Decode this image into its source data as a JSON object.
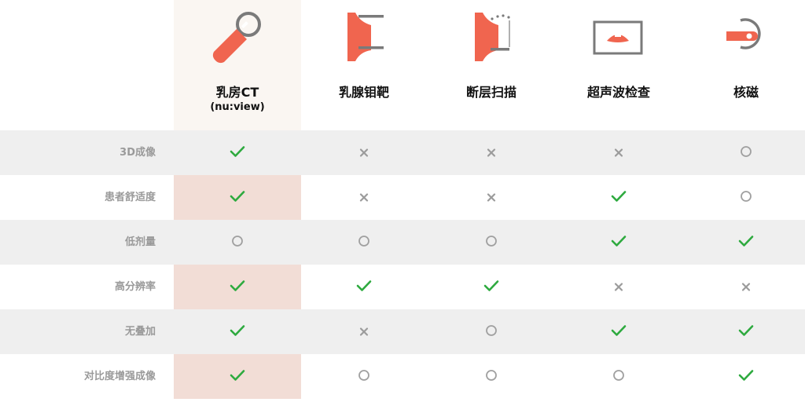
{
  "colors": {
    "accent": "#f0654f",
    "check": "#2eaa3f",
    "cross": "#9b9b9b",
    "circle": "#a0a0a0",
    "highlight_header": "#faf6f2",
    "highlight_cell": "#f2ddd6",
    "stripe": "#efefef"
  },
  "columns": [
    {
      "name": "乳房CT",
      "sub": "(nu:view)",
      "icon": "breast-ct-scanner-icon"
    },
    {
      "name": "乳腺钼靶",
      "sub": "",
      "icon": "mammography-compression-icon"
    },
    {
      "name": "断层扫描",
      "sub": "",
      "icon": "tomosynthesis-icon"
    },
    {
      "name": "超声波检查",
      "sub": "",
      "icon": "ultrasound-monitor-icon"
    },
    {
      "name": "核磁",
      "sub": "",
      "icon": "mri-scanner-icon"
    }
  ],
  "rows": [
    {
      "label": "3D成像",
      "values": [
        "check",
        "cross",
        "cross",
        "cross",
        "circle"
      ]
    },
    {
      "label": "患者舒适度",
      "values": [
        "check",
        "cross",
        "cross",
        "check",
        "circle"
      ]
    },
    {
      "label": "低剂量",
      "values": [
        "circle",
        "circle",
        "circle",
        "check",
        "check"
      ]
    },
    {
      "label": "高分辨率",
      "values": [
        "check",
        "check",
        "check",
        "cross",
        "cross"
      ]
    },
    {
      "label": "无叠加",
      "values": [
        "check",
        "cross",
        "circle",
        "check",
        "check"
      ]
    },
    {
      "label": "对比度增强成像",
      "values": [
        "check",
        "circle",
        "circle",
        "circle",
        "check"
      ]
    }
  ]
}
